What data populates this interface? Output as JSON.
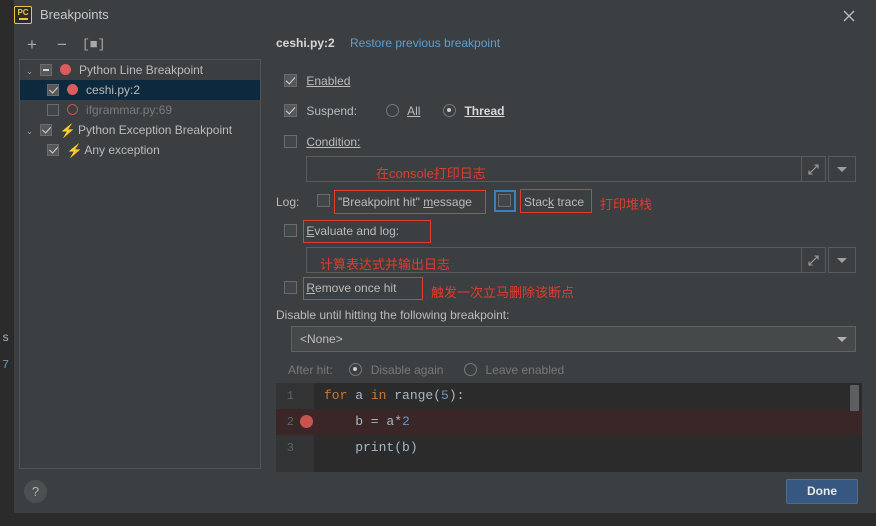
{
  "window": {
    "title": "Breakpoints",
    "app_icon": "pycharm-icon",
    "close_icon": "close-icon"
  },
  "ide_background": {
    "fragment_1": "s",
    "fragment_2": "7"
  },
  "tree_toolbar": {
    "add_label": "+",
    "remove_label": "−",
    "groups_label": "[■]"
  },
  "tree": {
    "items": [
      {
        "label": "Python Line Breakpoint",
        "twisty": "⌄",
        "checkbox": "mixed",
        "icon": "breakpoint-dot",
        "level": 0,
        "selected": false,
        "disabled": false
      },
      {
        "label": "ceshi.py:2",
        "twisty": "",
        "checkbox": "checked",
        "icon": "breakpoint-dot",
        "level": 1,
        "selected": true,
        "disabled": false
      },
      {
        "label": "ifgrammar.py:69",
        "twisty": "",
        "checkbox": "empty",
        "icon": "breakpoint-dot-hollow",
        "level": 1,
        "selected": false,
        "disabled": true
      },
      {
        "label": "Python Exception Breakpoint",
        "twisty": "⌄",
        "checkbox": "checked",
        "icon": "exception-bolt",
        "level": 0,
        "selected": false,
        "disabled": false
      },
      {
        "label": "Any exception",
        "twisty": "",
        "checkbox": "checked",
        "icon": "exception-bolt",
        "level": 1,
        "selected": false,
        "disabled": false
      }
    ]
  },
  "details": {
    "breakpoint_name": "ceshi.py:2",
    "restore_link": "Restore previous breakpoint",
    "enabled": {
      "label": "Enabled",
      "checked": true
    },
    "suspend": {
      "label": "Suspend:",
      "checked": true,
      "options": [
        {
          "label": "All",
          "selected": false
        },
        {
          "label": "Thread",
          "selected": true
        }
      ]
    },
    "condition": {
      "label": "Condition:",
      "checked": false,
      "value": "",
      "expand_icon": "expand-icon",
      "dropdown_icon": "chevron-down-icon"
    },
    "log": {
      "label": "Log:",
      "message_option": {
        "label": "\"Breakpoint hit\" message",
        "checked": false
      },
      "stack_option": {
        "label": "Stack trace",
        "checked": false
      }
    },
    "evaluate_and_log": {
      "label": "Evaluate and log:",
      "checked": false,
      "value": "",
      "expand_icon": "expand-icon",
      "dropdown_icon": "chevron-down-icon"
    },
    "remove_once_hit": {
      "label": "Remove once hit",
      "checked": false
    },
    "disable_until": {
      "label": "Disable until hitting the following breakpoint:",
      "selected_value": "<None>",
      "dropdown_icon": "chevron-down-icon"
    },
    "after_hit": {
      "label": "After hit:",
      "options": [
        {
          "label": "Disable again",
          "selected": true
        },
        {
          "label": "Leave enabled",
          "selected": false
        }
      ]
    }
  },
  "annotations": {
    "condition_note": "在console打印日志",
    "stack_note": "打印堆栈",
    "evaluate_note": "计算表达式并输出日志",
    "remove_note": "触发一次立马删除该断点"
  },
  "code_preview": {
    "lines": [
      {
        "number": "1",
        "has_breakpoint": false,
        "highlighted": false,
        "tokens": [
          {
            "text": "for",
            "cls": "kw"
          },
          {
            "text": " a ",
            "cls": ""
          },
          {
            "text": "in",
            "cls": "kw"
          },
          {
            "text": " range(",
            "cls": ""
          },
          {
            "text": "5",
            "cls": "num"
          },
          {
            "text": "):",
            "cls": ""
          }
        ]
      },
      {
        "number": "2",
        "has_breakpoint": true,
        "highlighted": true,
        "tokens": [
          {
            "text": "    b = a*",
            "cls": ""
          },
          {
            "text": "2",
            "cls": "num"
          }
        ]
      },
      {
        "number": "3",
        "has_breakpoint": false,
        "highlighted": false,
        "tokens": [
          {
            "text": "    print(b)",
            "cls": ""
          }
        ]
      }
    ]
  },
  "footer": {
    "help_label": "?",
    "done_label": "Done"
  },
  "colors": {
    "dialog_bg": "#3c3f41",
    "editor_bg": "#2b2b2b",
    "selection_bg": "#0d293e",
    "link": "#5a9fd4",
    "annotation_red": "#e33b2e",
    "breakpoint_red": "#db5c5c",
    "accent_button": "#365880",
    "focus_blue": "#3e7fb5"
  }
}
